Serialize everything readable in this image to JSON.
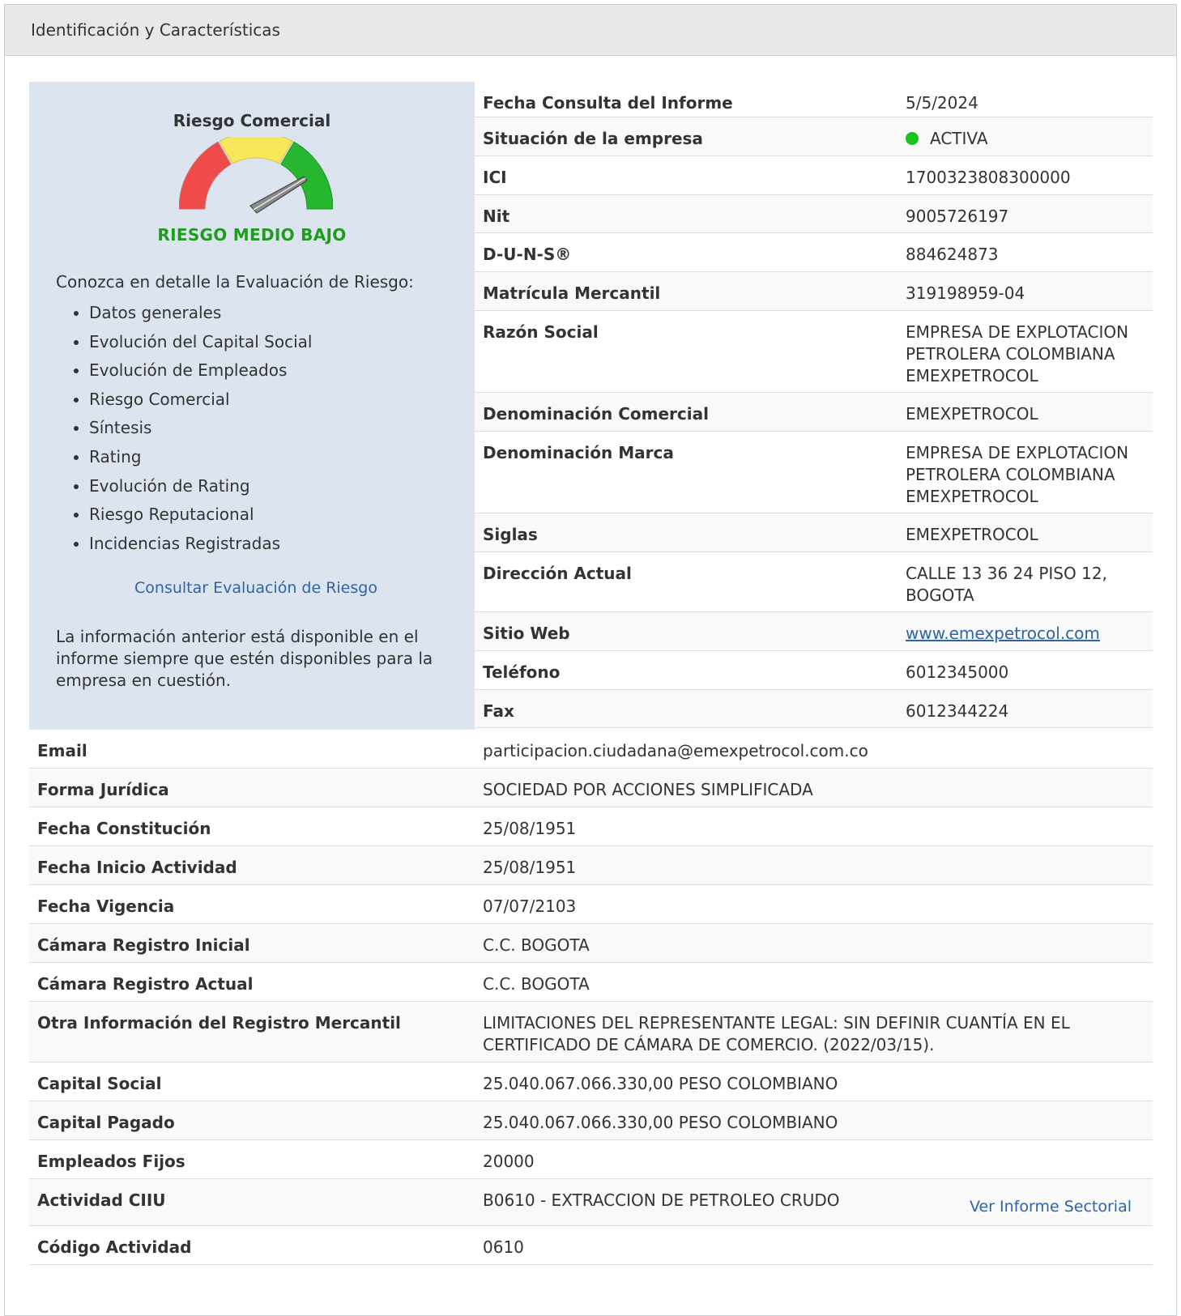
{
  "header": {
    "title": "Identificación y Características"
  },
  "risk": {
    "title": "Riesgo Comercial",
    "level_label": "RIESGO MEDIO BAJO",
    "gauge_colors": [
      "#f04b4b",
      "#f7e75a",
      "#27b62f"
    ],
    "needle_icon": "gauge-needle-icon",
    "intro": "Conozca en detalle la Evaluación de Riesgo:",
    "items": [
      "Datos generales",
      "Evolución del Capital Social",
      "Evolución de Empleados",
      "Riesgo Comercial",
      "Síntesis",
      "Rating",
      "Evolución de Rating",
      "Riesgo Reputacional",
      "Incidencias Registradas"
    ],
    "link": "Consultar Evaluación de Riesgo",
    "note": "La información anterior está disponible en el informe siempre que estén disponibles para la empresa en cuestión."
  },
  "company": {
    "fecha_consulta": {
      "label": "Fecha Consulta del Informe",
      "value": "5/5/2024"
    },
    "situacion": {
      "label": "Situación de la empresa",
      "value": "ACTIVA",
      "status_color": "#16c51a"
    },
    "ici": {
      "label": "ICI",
      "value": "1700323808300000"
    },
    "nit": {
      "label": "Nit",
      "value": "9005726197"
    },
    "duns": {
      "label": "D-U-N-S®",
      "value": "884624873"
    },
    "matricula": {
      "label": "Matrícula Mercantil",
      "value": "319198959-04"
    },
    "razon_social": {
      "label": "Razón Social",
      "value": "EMPRESA DE EXPLOTACION PETROLERA COLOMBIANA EMEXPETROCOL"
    },
    "denominacion_comercial": {
      "label": "Denominación Comercial",
      "value": "EMEXPETROCOL"
    },
    "denominacion_marca": {
      "label": "Denominación Marca",
      "value": "EMPRESA DE EXPLOTACION PETROLERA COLOMBIANA EMEXPETROCOL"
    },
    "siglas": {
      "label": "Siglas",
      "value": "EMEXPETROCOL"
    },
    "direccion": {
      "label": "Dirección Actual",
      "value": "CALLE 13 36 24 PISO 12, BOGOTA"
    },
    "sitio_web": {
      "label": "Sitio Web",
      "value": "www.emexpetrocol.com"
    },
    "telefono": {
      "label": "Teléfono",
      "value": "6012345000"
    },
    "fax": {
      "label": "Fax",
      "value": "6012344224"
    },
    "email": {
      "label": "Email",
      "value": "participacion.ciudadana@emexpetrocol.com.co"
    },
    "forma_juridica": {
      "label": "Forma Jurídica",
      "value": "SOCIEDAD POR ACCIONES SIMPLIFICADA"
    },
    "fecha_constitucion": {
      "label": "Fecha Constitución",
      "value": "25/08/1951"
    },
    "fecha_inicio": {
      "label": "Fecha Inicio Actividad",
      "value": "25/08/1951"
    },
    "fecha_vigencia": {
      "label": "Fecha Vigencia",
      "value": "07/07/2103"
    },
    "camara_inicial": {
      "label": "Cámara Registro Inicial",
      "value": "C.C. BOGOTA"
    },
    "camara_actual": {
      "label": "Cámara Registro Actual",
      "value": "C.C. BOGOTA"
    },
    "otra_info": {
      "label": "Otra Información del Registro Mercantil",
      "value": "LIMITACIONES DEL REPRESENTANTE LEGAL: SIN DEFINIR CUANTÍA EN EL CERTIFICADO DE CÁMARA DE COMERCIO. (2022/03/15)."
    },
    "capital_social": {
      "label": "Capital Social",
      "value": "25.040.067.066.330,00 PESO COLOMBIANO"
    },
    "capital_pagado": {
      "label": "Capital Pagado",
      "value": "25.040.067.066.330,00 PESO COLOMBIANO"
    },
    "empleados": {
      "label": "Empleados Fijos",
      "value": "20000"
    },
    "ciiu": {
      "label": "Actividad CIIU",
      "value": "B0610 - EXTRACCION DE PETROLEO CRUDO",
      "link": "Ver Informe Sectorial"
    },
    "codigo_actividad": {
      "label": "Código Actividad",
      "value": "0610"
    }
  }
}
